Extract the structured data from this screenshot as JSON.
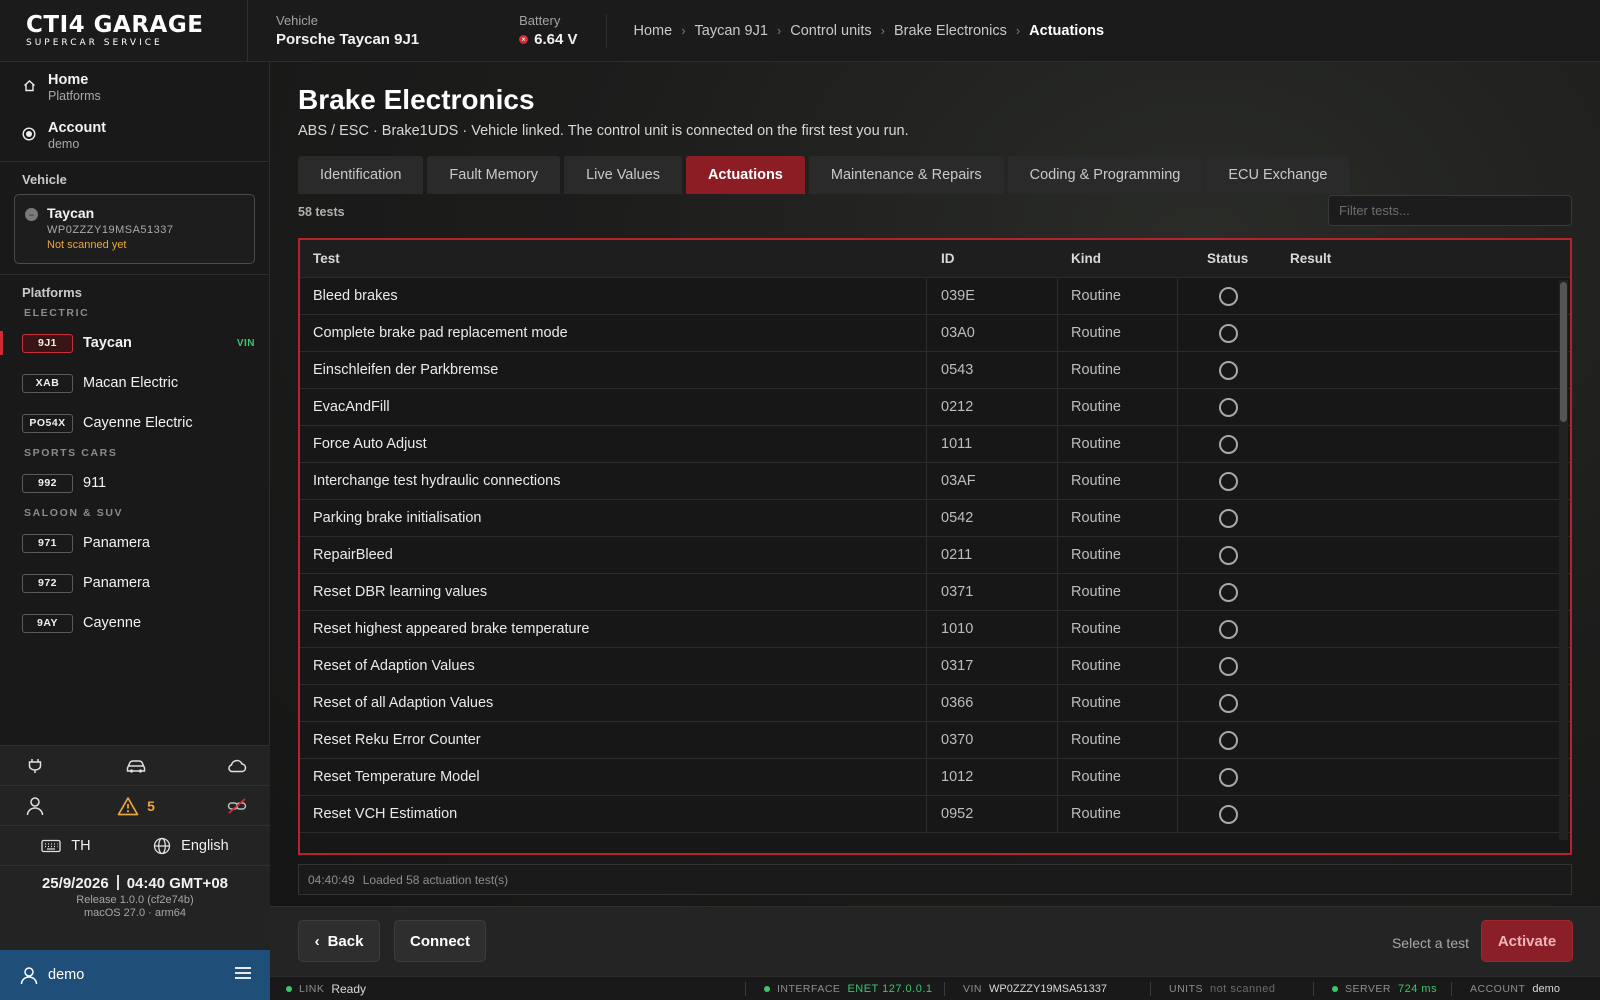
{
  "brand": {
    "name": "CTI4 GARAGE",
    "tagline": "SUPERCAR SERVICE"
  },
  "topbar": {
    "vehicle_label": "Vehicle",
    "vehicle_value": "Porsche Taycan 9J1",
    "battery_label": "Battery",
    "battery_value": "6.64 V",
    "battery_status_color": "#d72a34"
  },
  "breadcrumb": [
    "Home",
    "Taycan 9J1",
    "Control units",
    "Brake Electronics",
    "Actuations"
  ],
  "sidebar": {
    "home": {
      "title": "Home",
      "sub": "Platforms"
    },
    "account": {
      "title": "Account",
      "sub": "demo"
    },
    "vehicle_heading": "Vehicle",
    "vehicle_card": {
      "name": "Taycan",
      "vin": "WP0ZZZY19MSA51337",
      "status": "Not scanned yet"
    },
    "platforms_heading": "Platforms",
    "groups": [
      {
        "label": "ELECTRIC",
        "items": [
          {
            "code": "9J1",
            "name": "Taycan",
            "badge": "VIN",
            "active": true
          },
          {
            "code": "XAB",
            "name": "Macan Electric"
          },
          {
            "code": "PO54X",
            "name": "Cayenne Electric"
          }
        ]
      },
      {
        "label": "SPORTS CARS",
        "items": [
          {
            "code": "992",
            "name": "911"
          }
        ]
      },
      {
        "label": "SALOON & SUV",
        "items": [
          {
            "code": "971",
            "name": "Panamera"
          },
          {
            "code": "972",
            "name": "Panamera"
          },
          {
            "code": "9AY",
            "name": "Cayenne"
          }
        ]
      }
    ],
    "warnings_count": "5",
    "keyboard_label": "TH",
    "language_label": "English",
    "date": "25/9/2026",
    "time": "04:40 GMT+08",
    "release": "Release 1.0.0 (cf2e74b)",
    "os": "macOS 27.0 · arm64",
    "user": "demo"
  },
  "main": {
    "title": "Brake Electronics",
    "subtitle": "ABS / ESC · Brake1UDS · Vehicle linked. The control unit is connected on the first test you run.",
    "tabs": [
      "Identification",
      "Fault Memory",
      "Live Values",
      "Actuations",
      "Maintenance & Repairs",
      "Coding & Programming",
      "ECU Exchange"
    ],
    "active_tab": "Actuations",
    "count": "58 tests",
    "filter_placeholder": "Filter tests...",
    "columns": {
      "test": "Test",
      "id": "ID",
      "kind": "Kind",
      "status": "Status",
      "result": "Result"
    },
    "rows": [
      {
        "test": "Bleed brakes",
        "id": "039E",
        "kind": "Routine"
      },
      {
        "test": "Complete brake pad replacement mode",
        "id": "03A0",
        "kind": "Routine"
      },
      {
        "test": "Einschleifen der Parkbremse",
        "id": "0543",
        "kind": "Routine"
      },
      {
        "test": "EvacAndFill",
        "id": "0212",
        "kind": "Routine"
      },
      {
        "test": "Force Auto Adjust",
        "id": "1011",
        "kind": "Routine"
      },
      {
        "test": "Interchange test hydraulic connections",
        "id": "03AF",
        "kind": "Routine"
      },
      {
        "test": "Parking brake initialisation",
        "id": "0542",
        "kind": "Routine"
      },
      {
        "test": "RepairBleed",
        "id": "0211",
        "kind": "Routine"
      },
      {
        "test": "Reset DBR learning values",
        "id": "0371",
        "kind": "Routine"
      },
      {
        "test": "Reset highest appeared brake temperature",
        "id": "1010",
        "kind": "Routine"
      },
      {
        "test": "Reset of Adaption Values",
        "id": "0317",
        "kind": "Routine"
      },
      {
        "test": "Reset of all Adaption Values",
        "id": "0366",
        "kind": "Routine"
      },
      {
        "test": "Reset Reku Error Counter",
        "id": "0370",
        "kind": "Routine"
      },
      {
        "test": "Reset Temperature Model",
        "id": "1012",
        "kind": "Routine"
      },
      {
        "test": "Reset VCH Estimation",
        "id": "0952",
        "kind": "Routine"
      }
    ],
    "log_time": "04:40:49",
    "log_message": "Loaded 58 actuation test(s)"
  },
  "actions": {
    "back": "Back",
    "connect": "Connect",
    "hint": "Select a test",
    "activate": "Activate"
  },
  "statusbar": {
    "link_label": "LINK",
    "link_value": "Ready",
    "interface_label": "INTERFACE",
    "interface_value": "ENET 127.0.0.1",
    "vin_label": "VIN",
    "vin_value": "WP0ZZZY19MSA51337",
    "units_label": "UNITS",
    "units_value": "not scanned",
    "server_label": "SERVER",
    "server_value": "724 ms",
    "account_label": "ACCOUNT",
    "account_value": "demo"
  },
  "colors": {
    "accent": "#8c1d25",
    "table_border": "#b6222d",
    "ok": "#3ec46d",
    "warning": "#e8a63c",
    "user_bar": "#1f4e79"
  }
}
